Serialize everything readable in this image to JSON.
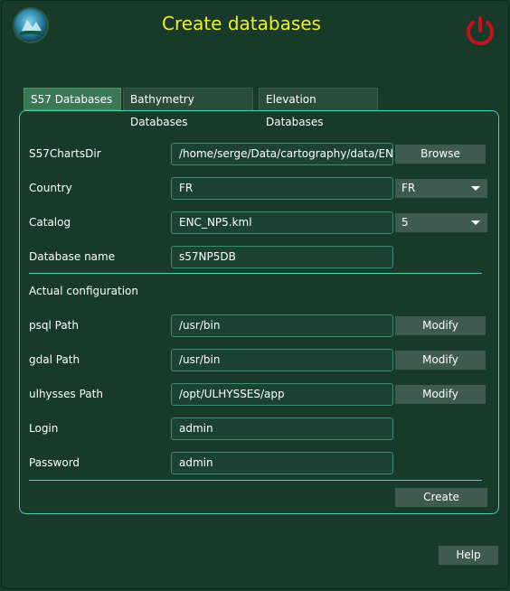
{
  "header": {
    "title": "Create databases",
    "logo_icon": "globe-logo-icon",
    "power_icon": "power-icon",
    "title_color": "#f2ef24",
    "power_color": "#c8101a"
  },
  "tabs": [
    {
      "label": "S57 Databases",
      "active": true
    },
    {
      "label": "Bathymetry Databases",
      "active": false
    },
    {
      "label": "Elevation Databases",
      "active": false
    }
  ],
  "form": {
    "charts_dir": {
      "label": "S57ChartsDir",
      "value": "/home/serge/Data/cartography/data/ENC",
      "button": "Browse"
    },
    "country": {
      "label": "Country",
      "value": "FR",
      "selected": "FR"
    },
    "catalog": {
      "label": "Catalog",
      "value": "ENC_NP5.kml",
      "selected": "5"
    },
    "database_name": {
      "label": "Database name",
      "value": "s57NP5DB"
    },
    "section_label": "Actual configuration",
    "psql": {
      "label": "psql Path",
      "value": "/usr/bin",
      "button": "Modify"
    },
    "gdal": {
      "label": "gdal Path",
      "value": "/usr/bin",
      "button": "Modify"
    },
    "ulhysses": {
      "label": "ulhysses Path",
      "value": "/opt/ULHYSSES/app",
      "button": "Modify"
    },
    "login": {
      "label": "Login",
      "value": "admin"
    },
    "password": {
      "label": "Password",
      "value": "admin"
    },
    "create_button": "Create"
  },
  "footer": {
    "help_button": "Help"
  }
}
